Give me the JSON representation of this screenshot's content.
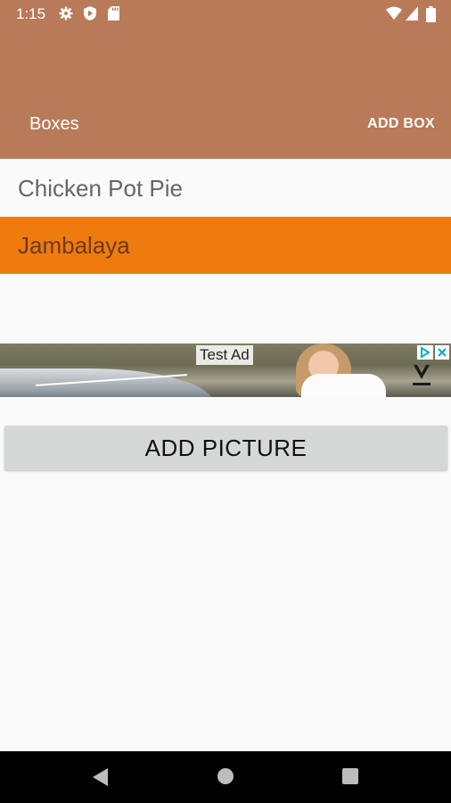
{
  "status_bar": {
    "time": "1:15",
    "icons": [
      "gear-icon",
      "shield-play-icon",
      "sd-card-icon",
      "wifi-icon",
      "signal-icon",
      "battery-icon"
    ]
  },
  "app_bar": {
    "title": "Boxes",
    "action_label": "ADD BOX",
    "color": "#b87a58"
  },
  "list": {
    "items": [
      {
        "label": "Chicken Pot Pie",
        "selected": false
      },
      {
        "label": "Jambalaya",
        "selected": true
      }
    ],
    "selected_color": "#ef7b0f"
  },
  "ad": {
    "label": "Test Ad",
    "icons": [
      "adchoices-icon",
      "close-icon",
      "brand-logo-icon"
    ]
  },
  "add_picture_button": {
    "label": "ADD PICTURE"
  },
  "nav_bar": {
    "icons": [
      "back-icon",
      "home-icon",
      "recents-icon"
    ]
  }
}
